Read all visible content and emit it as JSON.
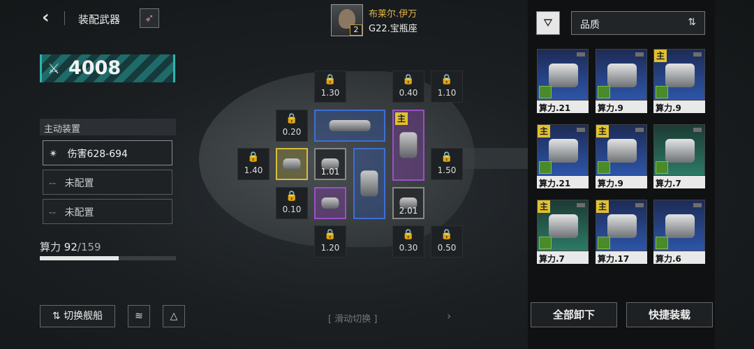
{
  "header": {
    "title": "装配武器",
    "back_icon": "chevron-left-icon",
    "ship_icon": "rocket-icon"
  },
  "pilot": {
    "name": "布莱尔.伊万",
    "level": "2",
    "ship": "G22.宝瓶座"
  },
  "power": {
    "value": "4008",
    "icon": "sword-icon"
  },
  "devices": {
    "title": "主动装置",
    "slots": [
      {
        "label": "伤害628-694",
        "filled": true
      },
      {
        "label": "未配置",
        "filled": false
      },
      {
        "label": "未配置",
        "filled": false
      }
    ],
    "dash": "--"
  },
  "capacity": {
    "label": "算力",
    "used": "92",
    "max": "159",
    "fraction": 0.58
  },
  "buttons": {
    "switch_ship": "切换舰船",
    "unload_all": "全部卸下",
    "quick_equip": "快捷装载"
  },
  "grid": {
    "locks": [
      "1.30",
      "0.40",
      "1.10",
      "0.20",
      "1.40",
      "1.50",
      "0.10",
      "1.20",
      "0.30",
      "0.50"
    ],
    "cells": [
      "1.01",
      "2.01"
    ],
    "main_tag": "主"
  },
  "swipe_hint": "滑动切换",
  "sort": {
    "label": "品质"
  },
  "cards": [
    {
      "label": "算力.21",
      "main": false,
      "color": "blue"
    },
    {
      "label": "算力.9",
      "main": false,
      "color": "blue"
    },
    {
      "label": "算力.9",
      "main": true,
      "color": "blue"
    },
    {
      "label": "算力.21",
      "main": true,
      "color": "blue"
    },
    {
      "label": "算力.9",
      "main": true,
      "color": "blue"
    },
    {
      "label": "算力.7",
      "main": false,
      "color": "green"
    },
    {
      "label": "算力.7",
      "main": true,
      "color": "green"
    },
    {
      "label": "算力.17",
      "main": true,
      "color": "blue"
    },
    {
      "label": "算力.6",
      "main": false,
      "color": "blue"
    }
  ]
}
